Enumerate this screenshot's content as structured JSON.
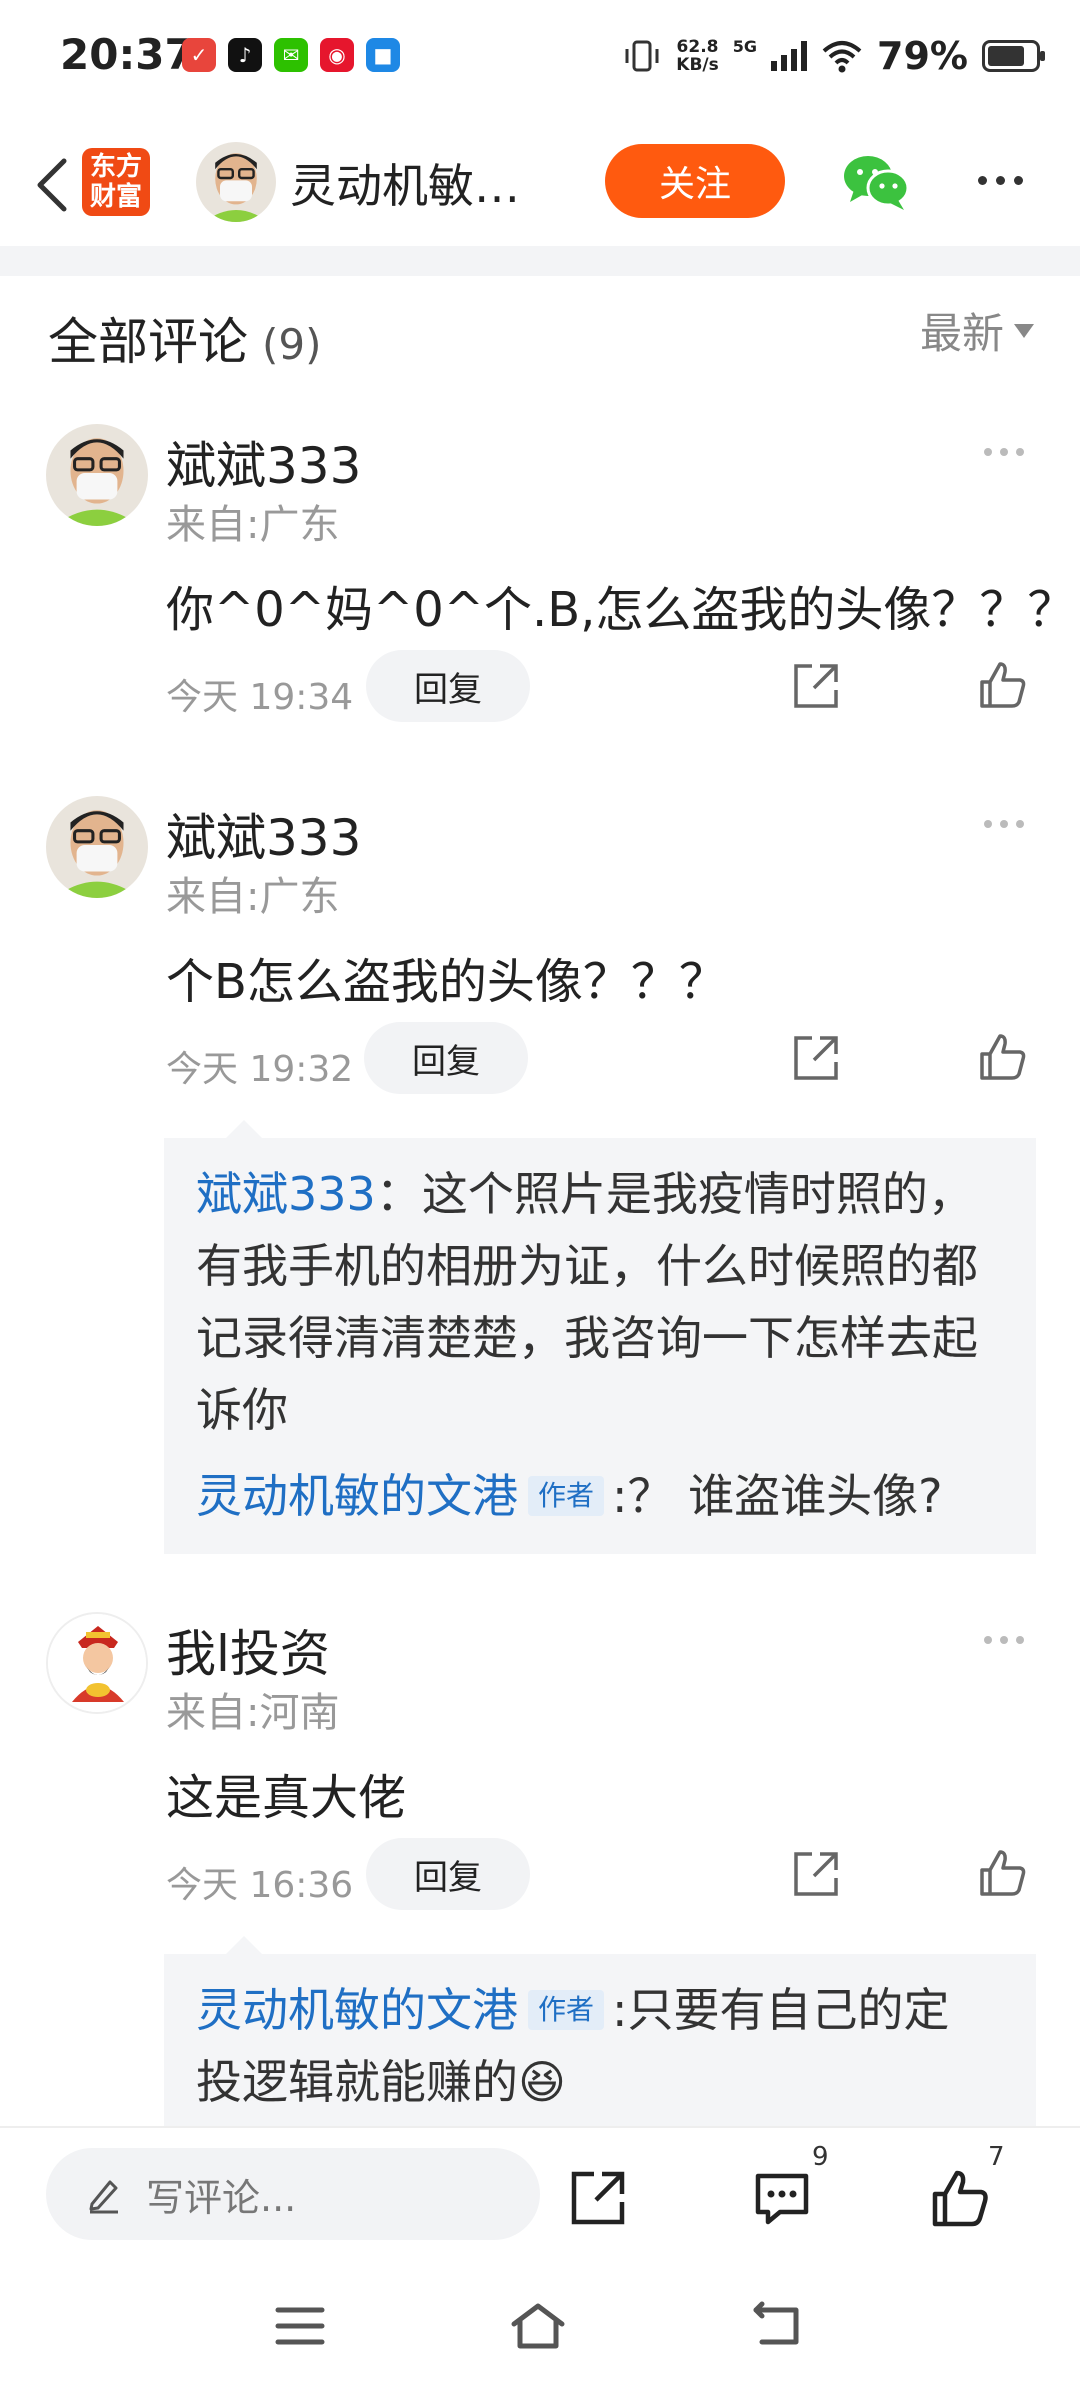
{
  "status_bar": {
    "time": "20:37",
    "net_speed_value": "62.8",
    "net_speed_unit": "KB/s",
    "network": "5G",
    "battery_percent": "79%",
    "battery_level": 0.79
  },
  "header": {
    "logo_line1": "东方",
    "logo_line2": "财富",
    "author_name": "灵动机敏…",
    "follow_label": "关注"
  },
  "comments_section": {
    "title": "全部评论",
    "count": "(9)",
    "sort_label": "最新"
  },
  "comments": [
    {
      "user": "斌斌333",
      "location": "来自:广东",
      "text": "你^0^妈^0^个.B,怎么盗我的头像？？？",
      "time": "今天 19:34",
      "reply_label": "回复"
    },
    {
      "user": "斌斌333",
      "location": "来自:广东",
      "text": "个B怎么盗我的头像？？？",
      "time": "今天 19:32",
      "reply_label": "回复",
      "replies": [
        {
          "name": "斌斌333",
          "sep": "：",
          "lines": [
            "这个照片是我疫情时照的，",
            "有我手机的相册为证，什么时候照的都",
            "记录得清清楚楚，我咨询一下怎样去起",
            "诉你"
          ]
        },
        {
          "name": "灵动机敏的文港",
          "tag": "作者",
          "text": ":？ 谁盗谁头像?"
        }
      ]
    },
    {
      "user": "我l投资",
      "location": "来自:河南",
      "text": "这是真大佬",
      "time": "今天 16:36",
      "reply_label": "回复",
      "replies": [
        {
          "name": "灵动机敏的文港",
          "tag": "作者",
          "text": ":只要有自己的定",
          "text2": "投逻辑就能赚的😆"
        }
      ]
    }
  ],
  "bottom_bar": {
    "write_placeholder": "写评论...",
    "comment_count": "9",
    "like_count": "7"
  },
  "colors": {
    "accent": "#ff5a0f",
    "link_blue": "#1f6fc4",
    "logo_red": "#f04a14"
  }
}
